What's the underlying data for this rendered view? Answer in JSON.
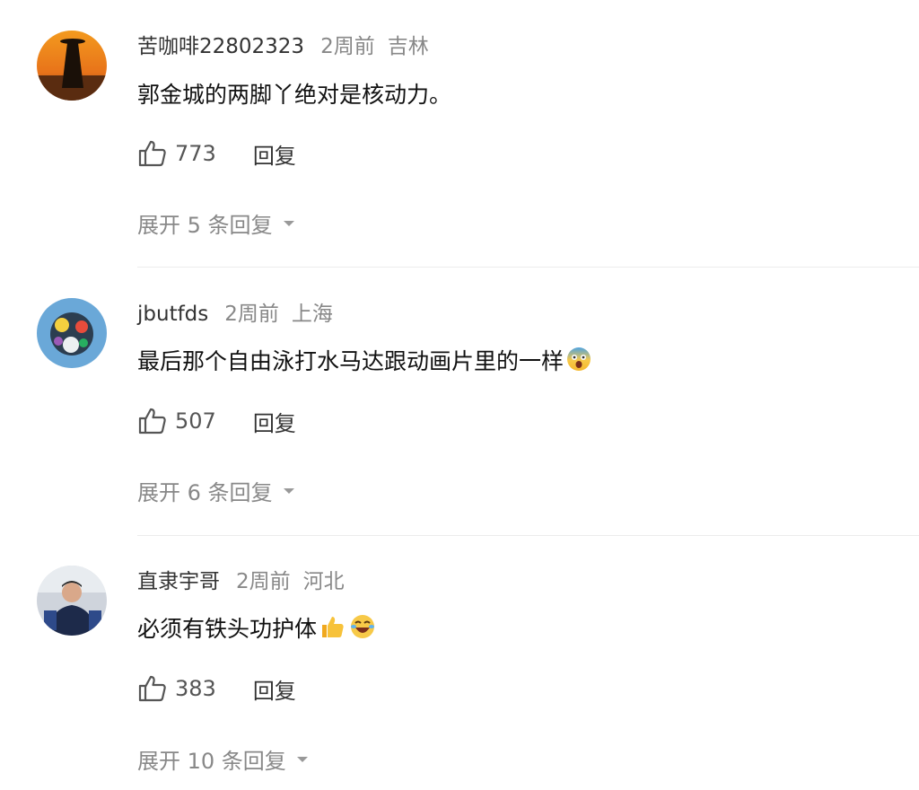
{
  "comments": [
    {
      "username": "苦咖啡22802323",
      "time": "2周前",
      "location": "吉林",
      "text": "郭金城的两脚丫绝对是核动力。",
      "likes": "773",
      "reply_label": "回复",
      "expand_label": "展开 5 条回复"
    },
    {
      "username": "jbutfds",
      "time": "2周前",
      "location": "上海",
      "text": "最后那个自由泳打水马达跟动画片里的一样",
      "emojis": [
        "fearful-face-emoji"
      ],
      "likes": "507",
      "reply_label": "回复",
      "expand_label": "展开 6 条回复"
    },
    {
      "username": "直隶宇哥",
      "time": "2周前",
      "location": "河北",
      "text": "必须有铁头功护体",
      "emojis": [
        "thumbs-up-emoji",
        "laughing-face-emoji"
      ],
      "likes": "383",
      "reply_label": "回复",
      "expand_label": "展开 10 条回复"
    }
  ],
  "colors": {
    "username": "#333333",
    "meta": "#888888",
    "text": "#111111",
    "divider": "#ececec"
  },
  "icons": [
    "thumbs-up-outline-icon",
    "caret-down-icon"
  ]
}
